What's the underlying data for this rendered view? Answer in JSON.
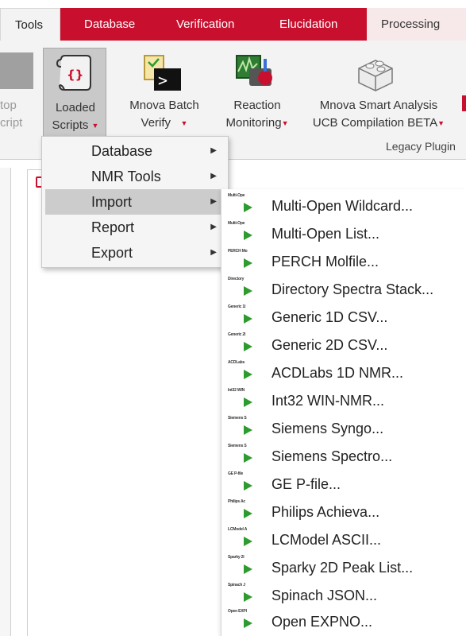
{
  "tabs": [
    {
      "label": "Tools",
      "state": "active"
    },
    {
      "label": "Database",
      "state": "normal"
    },
    {
      "label": "Verification",
      "state": "normal"
    },
    {
      "label": "Elucidation",
      "state": "normal"
    },
    {
      "label": "Processing",
      "state": "light"
    }
  ],
  "ribbon": {
    "stop_script": {
      "line1": "top",
      "line2": "cript"
    },
    "loaded_scripts": {
      "line1": "Loaded",
      "line2": "Scripts"
    },
    "batch_verify": {
      "line1": "Mnova Batch",
      "line2": "Verify"
    },
    "reaction_monitoring": {
      "line1": "Reaction",
      "line2": "Monitoring"
    },
    "smart_analysis": {
      "line1": "Mnova Smart Analysis",
      "line2": "UCB Compilation BETA"
    },
    "group_label": "Legacy Plugin"
  },
  "menu": {
    "items": [
      {
        "label": "Database",
        "has_submenu": true
      },
      {
        "label": "NMR Tools",
        "has_submenu": true
      },
      {
        "label": "Import",
        "has_submenu": true,
        "highlighted": true
      },
      {
        "label": "Report",
        "has_submenu": true
      },
      {
        "label": "Export",
        "has_submenu": true
      }
    ]
  },
  "submenu": {
    "items": [
      {
        "label": "Multi-Open Wildcard...",
        "thumb": "Multi-Ope"
      },
      {
        "label": "Multi-Open List...",
        "thumb": "Multi-Ope"
      },
      {
        "label": "PERCH Molfile...",
        "thumb": "PERCH Mo"
      },
      {
        "label": "Directory Spectra Stack...",
        "thumb": "Directory"
      },
      {
        "label": "Generic 1D CSV...",
        "thumb": "Generic 1I"
      },
      {
        "label": "Generic 2D CSV...",
        "thumb": "Generic 2I"
      },
      {
        "label": "ACDLabs 1D NMR...",
        "thumb": "ACDLabs"
      },
      {
        "label": "Int32 WIN-NMR...",
        "thumb": "Int32 WIN"
      },
      {
        "label": "Siemens Syngo...",
        "thumb": "Siemens S"
      },
      {
        "label": "Siemens Spectro...",
        "thumb": "Siemens S"
      },
      {
        "label": "GE P-file...",
        "thumb": "GE P-file"
      },
      {
        "label": "Philips Achieva...",
        "thumb": "Philips Ac"
      },
      {
        "label": "LCModel ASCII...",
        "thumb": "LCModel A"
      },
      {
        "label": "Sparky 2D Peak List...",
        "thumb": "Sparky 2I"
      },
      {
        "label": "Spinach JSON...",
        "thumb": "Spinach J"
      },
      {
        "label": "Open EXPNO...",
        "thumb": "Open EXPI"
      }
    ]
  },
  "colors": {
    "accent": "#c8102e",
    "play": "#2e9b2e",
    "highlight": "#cccccc"
  }
}
